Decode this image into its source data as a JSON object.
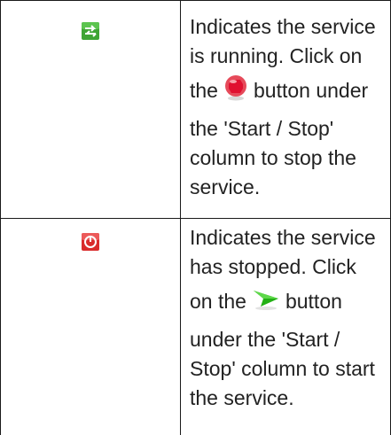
{
  "rows": [
    {
      "icon": "service-running-icon",
      "icon_color": "#3fa535",
      "desc_line1": "Indicates the service",
      "desc_line2": "is running. Click on",
      "desc_pre_icon": "the",
      "inline_icon": "stop-button-icon",
      "inline_icon_color": "#e02020",
      "desc_post_icon": "button under",
      "desc_line4": "the 'Start / Stop'",
      "desc_line5": "column to stop the",
      "desc_line6": "service."
    },
    {
      "icon": "service-stopped-icon",
      "icon_color": "#d92b2b",
      "desc_line1": "Indicates the service",
      "desc_line2": "has stopped. Click",
      "desc_pre_icon": "on the",
      "inline_icon": "start-button-icon",
      "inline_icon_color": "#2fbf1f",
      "desc_post_icon": "button",
      "desc_line4": "under the 'Start /",
      "desc_line5": "Stop' column to start",
      "desc_line6": "the service."
    }
  ]
}
